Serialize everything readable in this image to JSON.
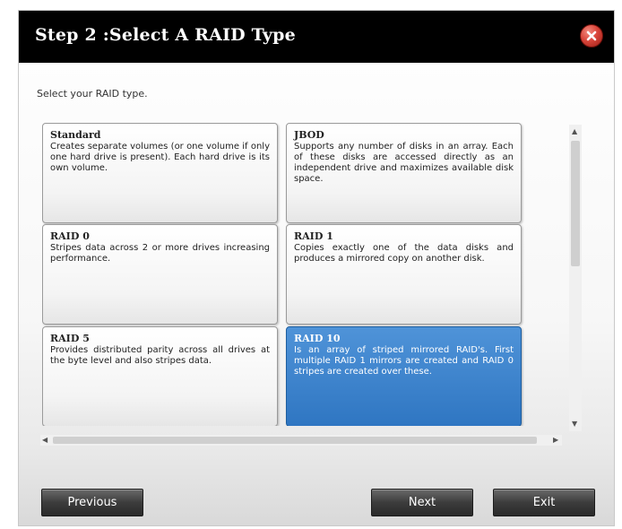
{
  "dialog": {
    "title": "Step 2 :Select A RAID Type",
    "prompt": "Select your RAID type."
  },
  "options": [
    {
      "name": "Standard",
      "description": "Creates separate volumes (or one volume if only one hard drive is present). Each hard drive is its own volume.",
      "selected": false
    },
    {
      "name": "JBOD",
      "description": "Supports any number of disks in an array. Each of these disks are accessed directly as an independent drive and maximizes available disk space.",
      "selected": false
    },
    {
      "name": "RAID 0",
      "description": "Stripes data across 2 or more drives increasing performance.",
      "selected": false
    },
    {
      "name": "RAID 1",
      "description": "Copies exactly one of the data disks and produces a mirrored copy on another disk.",
      "selected": false
    },
    {
      "name": "RAID 5",
      "description": "Provides distributed parity across all drives at the byte level and also stripes data.",
      "selected": false
    },
    {
      "name": "RAID 10",
      "description": "Is an array of striped mirrored RAID's. First multiple RAID 1 mirrors are created and RAID 0 stripes are created over these.",
      "selected": true
    }
  ],
  "buttons": {
    "previous": "Previous",
    "next": "Next",
    "exit": "Exit"
  },
  "colors": {
    "titlebar": "#000000",
    "selected_card": "#2f76c2",
    "button": "#3c3c3c"
  }
}
